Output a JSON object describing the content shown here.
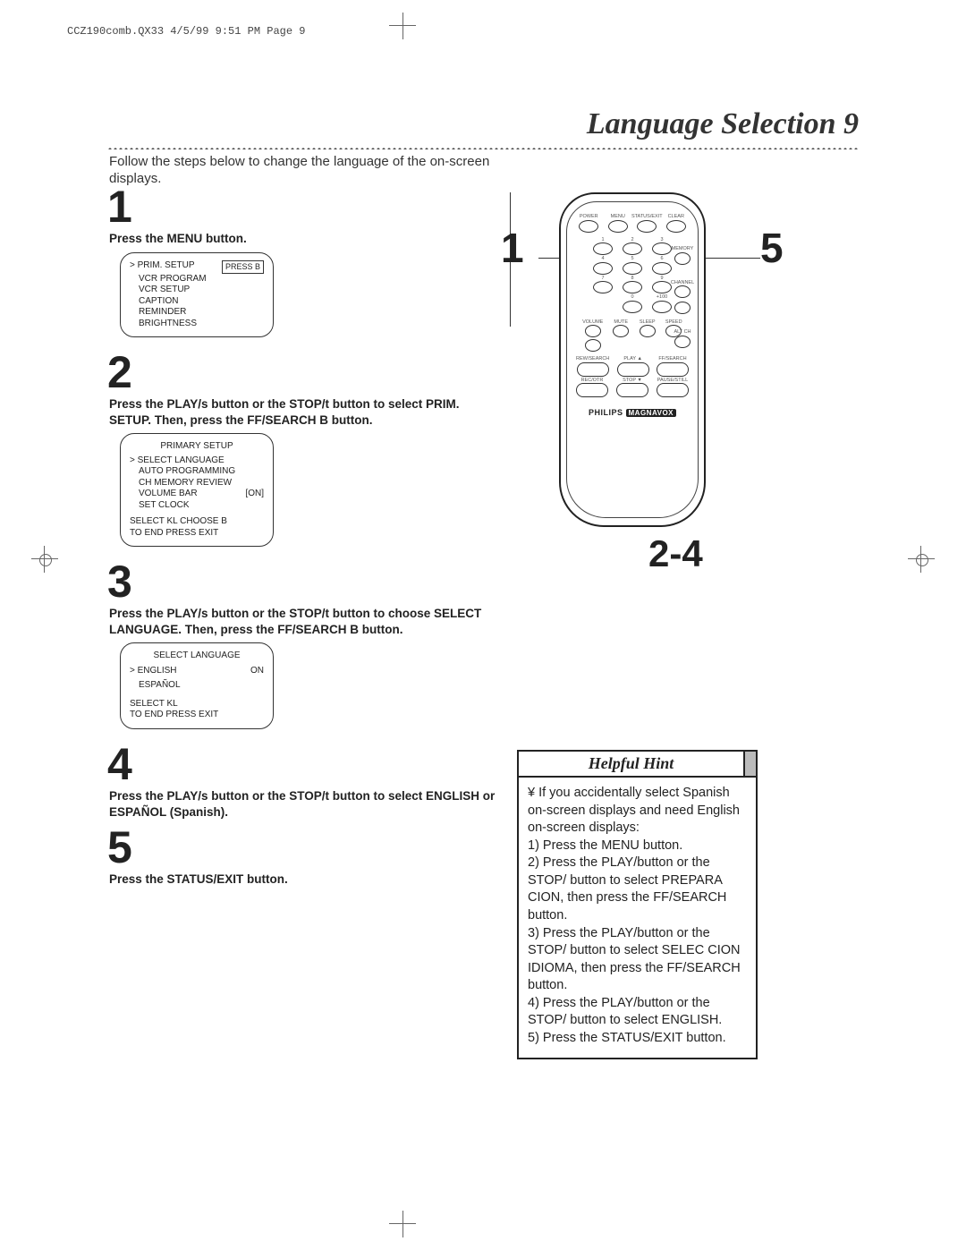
{
  "header_note": "CCZ190comb.QX33  4/5/99 9:51 PM  Page 9",
  "title": "Language Selection",
  "page_number": "9",
  "intro": "Follow the steps below to change the language of the on-screen displays.",
  "steps": {
    "s1": {
      "num": "1",
      "text": "Press the MENU button.",
      "osd": {
        "items": [
          "PRIM. SETUP",
          "VCR PROGRAM",
          "VCR SETUP",
          "CAPTION",
          "REMINDER",
          "BRIGHTNESS"
        ],
        "right": "PRESS B"
      }
    },
    "s2": {
      "num": "2",
      "text": "Press the PLAY/s  button or the STOP/t  button to select PRIM. SETUP. Then, press the FF/SEARCH B  button.",
      "osd": {
        "title": "PRIMARY SETUP",
        "items": [
          "SELECT LANGUAGE",
          "AUTO PROGRAMMING",
          "CH MEMORY REVIEW",
          "VOLUME BAR",
          "SET CLOCK"
        ],
        "vol_state": "[ON]",
        "footer1": "SELECT KL  CHOOSE B",
        "footer2": "TO  END  PRESS  EXIT"
      }
    },
    "s3": {
      "num": "3",
      "text": "Press the PLAY/s  button or the STOP/t  button to choose SELECT LANGUAGE. Then, press the FF/SEARCH B  button.",
      "osd": {
        "title": "SELECT LANGUAGE",
        "items": [
          "ENGLISH",
          "ESPAÑOL"
        ],
        "eng_state": "ON",
        "footer1": "SELECT KL",
        "footer2": "TO  END  PRESS  EXIT"
      }
    },
    "s4": {
      "num": "4",
      "text": "Press the PLAY/s  button or the STOP/t  button to select ENGLISH or ESPAÑOL (Spanish)."
    },
    "s5": {
      "num": "5",
      "text": "Press the STATUS/EXIT button."
    }
  },
  "remote": {
    "callout1": "1",
    "callout5": "5",
    "callout24": "2-4",
    "top_labels": [
      "POWER",
      "MENU",
      "STATUS/EXIT",
      "CLEAR"
    ],
    "keypad": [
      "1",
      "2",
      "3",
      "4",
      "5",
      "6",
      "7",
      "8",
      "9",
      "0",
      "+100"
    ],
    "right_labels": [
      "MEMORY",
      "CHANNEL",
      "ALT CH"
    ],
    "mid_labels": [
      "VOLUME",
      "MUTE",
      "SLEEP",
      "SPEED"
    ],
    "transport": [
      "REW/SEARCH",
      "PLAY ▲",
      "FF/SEARCH",
      "REC/OTR",
      "STOP ▼",
      "PAUSE/STILL"
    ],
    "brand1": "PHILIPS",
    "brand2": "MAGNAVOX"
  },
  "hint": {
    "title": "Helpful Hint",
    "body": "¥  If you accidentally select Spanish on-screen displays and need English on-screen displays:\n1) Press the MENU button.\n2) Press the PLAY/button or the STOP/ button to select PREPARA CION, then press the FF/SEARCH button.\n3) Press the PLAY/button or the STOP/ button to select SELEC CION IDIOMA, then press the FF/SEARCH button.\n4) Press the PLAY/button or the STOP/ button to select ENGLISH.\n5) Press the STATUS/EXIT button."
  }
}
